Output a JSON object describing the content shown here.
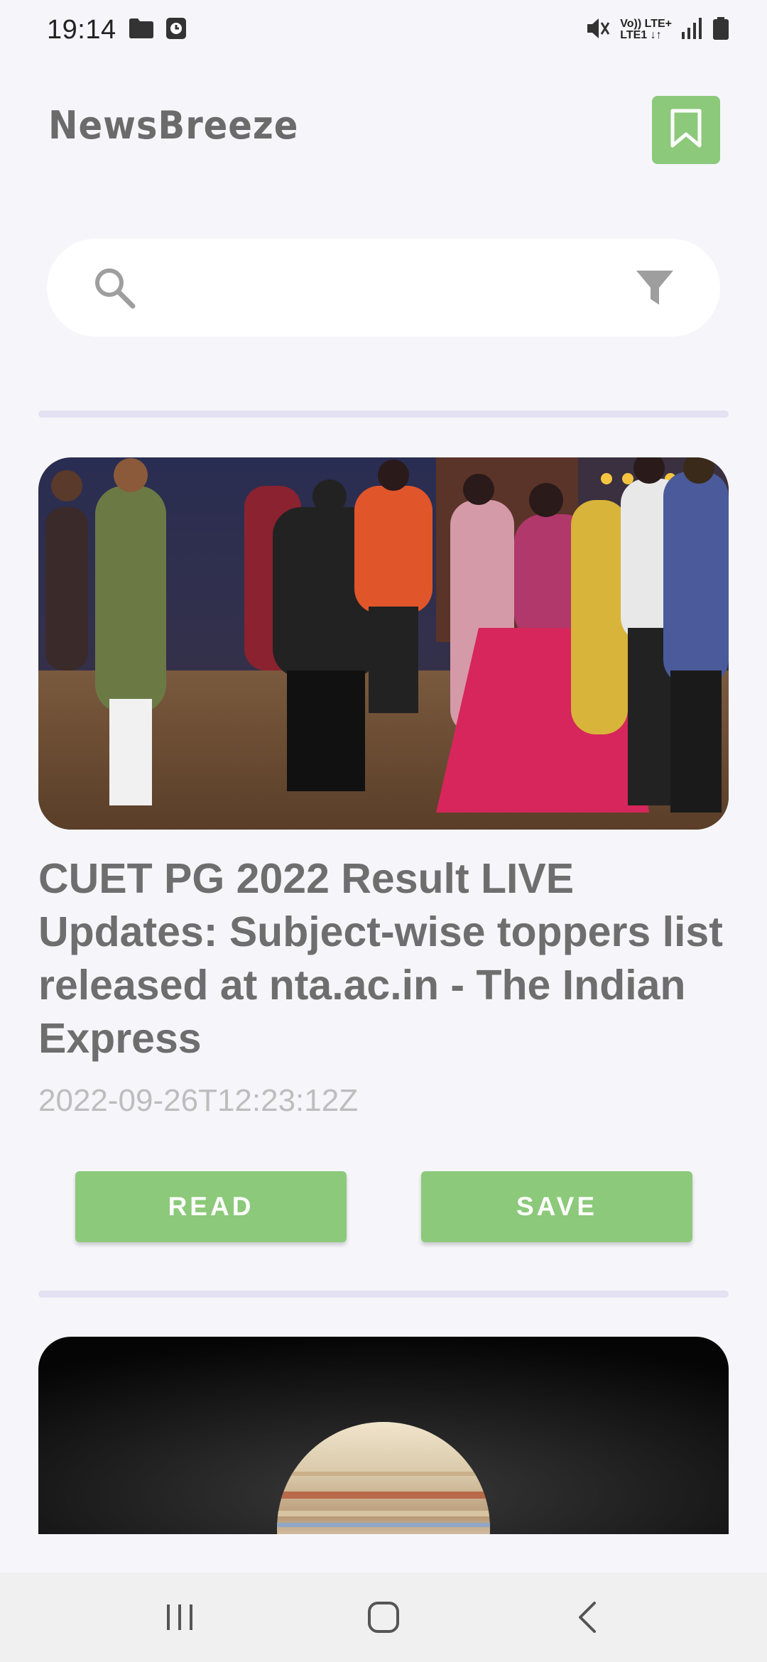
{
  "status_bar": {
    "time": "19:14",
    "network_top": "Vo)) LTE+",
    "network_bottom": "LTE1 ↓↑"
  },
  "header": {
    "app_title": "NewsBreeze",
    "bookmark_icon": "bookmark-icon"
  },
  "search": {
    "placeholder": "",
    "value": "",
    "search_icon": "search-icon",
    "filter_icon": "filter-icon"
  },
  "articles": [
    {
      "title": "CUET PG 2022 Result LIVE Updates: Subject-wise toppers list released at nta.ac.in - The Indian Express",
      "date": "2022-09-26T12:23:12Z",
      "read_label": "READ",
      "save_label": "SAVE"
    }
  ],
  "colors": {
    "accent_green": "#8cc97a",
    "background": "#f6f6fa",
    "divider": "#e3e1f2",
    "title_text": "#6e6e6e",
    "date_text": "#bdbdbd"
  },
  "nav_bar": {
    "recents_icon": "recents-icon",
    "home_icon": "home-icon",
    "back_icon": "back-icon"
  }
}
